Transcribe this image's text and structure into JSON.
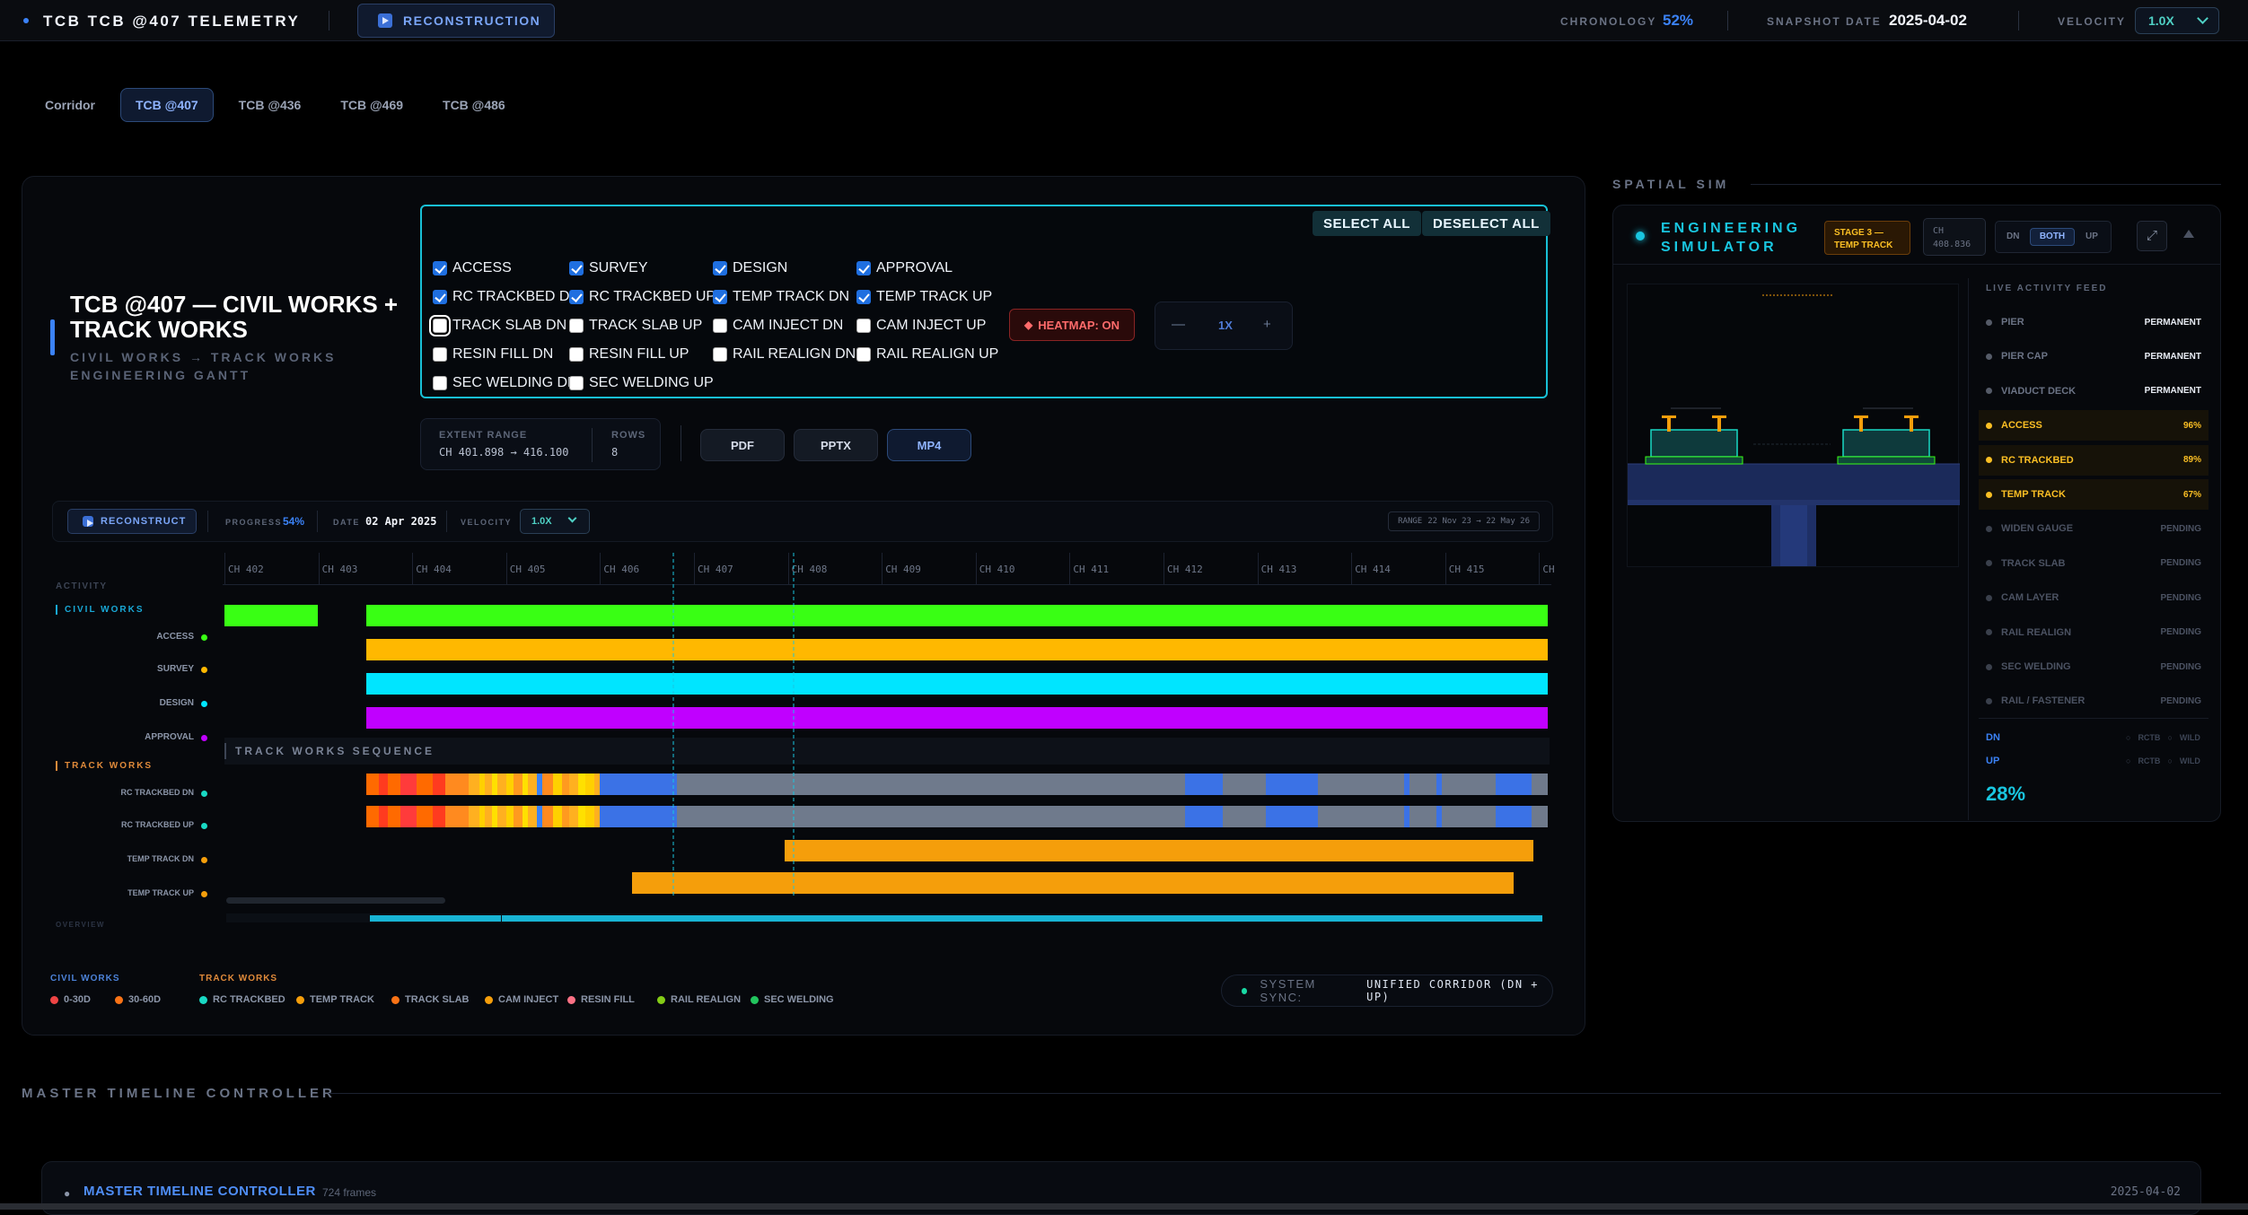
{
  "header": {
    "title": "TCB TCB @407 TELEMETRY",
    "reconstruction_label": "RECONSTRUCTION",
    "chronology_label": "CHRONOLOGY",
    "chronology_value": "52%",
    "snapshot_label": "SNAPSHOT DATE",
    "snapshot_value": "2025-04-02",
    "velocity_label": "VELOCITY",
    "velocity_value": "1.0X"
  },
  "tabs": [
    {
      "label": "Corridor",
      "active": false
    },
    {
      "label": "TCB @407",
      "active": true
    },
    {
      "label": "TCB @436",
      "active": false
    },
    {
      "label": "TCB @469",
      "active": false
    },
    {
      "label": "TCB @486",
      "active": false
    }
  ],
  "panel": {
    "title": "TCB @407 — CIVIL WORKS + TRACK WORKS",
    "subtitle_line1": "CIVIL WORKS → TRACK WORKS",
    "subtitle_line2": "ENGINEERING GANTT"
  },
  "filters": {
    "select_all": "SELECT ALL",
    "deselect_all": "DESELECT ALL",
    "items": [
      {
        "label": "ACCESS",
        "checked": true
      },
      {
        "label": "SURVEY",
        "checked": true
      },
      {
        "label": "DESIGN",
        "checked": true
      },
      {
        "label": "APPROVAL",
        "checked": true
      },
      {
        "label": "RC TRACKBED DN",
        "checked": true
      },
      {
        "label": "RC TRACKBED UP",
        "checked": true
      },
      {
        "label": "TEMP TRACK DN",
        "checked": true
      },
      {
        "label": "TEMP TRACK UP",
        "checked": true
      },
      {
        "label": "TRACK SLAB DN",
        "checked": false
      },
      {
        "label": "TRACK SLAB UP",
        "checked": false
      },
      {
        "label": "CAM INJECT DN",
        "checked": false
      },
      {
        "label": "CAM INJECT UP",
        "checked": false
      },
      {
        "label": "RESIN FILL DN",
        "checked": false
      },
      {
        "label": "RESIN FILL UP",
        "checked": false
      },
      {
        "label": "RAIL REALIGN DN",
        "checked": false
      },
      {
        "label": "RAIL REALIGN UP",
        "checked": false
      },
      {
        "label": "SEC WELDING DN",
        "checked": false
      },
      {
        "label": "SEC WELDING UP",
        "checked": false
      }
    ],
    "heatmap": "HEATMAP: ON",
    "zoom_minus": "—",
    "zoom_value": "1X",
    "zoom_plus": "+"
  },
  "extent": {
    "range_label": "EXTENT RANGE",
    "range_value": "CH 401.898 → 416.100",
    "rows_label": "ROWS",
    "rows_value": "8"
  },
  "exports": {
    "pdf": "PDF",
    "pptx": "PPTX",
    "mp4": "MP4"
  },
  "gantt_controls": {
    "reconstruct": "RECONSTRUCT",
    "progress_label": "PROGRESS",
    "progress_value": "54%",
    "date_label": "DATE",
    "date_value": "02 Apr 2025",
    "velocity_label": "VELOCITY",
    "velocity_value": "1.0X",
    "range_label": "RANGE",
    "range_value": "22 Nov 23 → 22 May 26"
  },
  "gantt": {
    "activity_header": "ACTIVITY",
    "overview_label": "OVERVIEW",
    "chainage_ticks": [
      "CH 402",
      "CH 403",
      "CH 404",
      "CH 405",
      "CH 406",
      "CH 407",
      "CH 408",
      "CH 409",
      "CH 410",
      "CH 411",
      "CH 412",
      "CH 413",
      "CH 414",
      "CH 415",
      "CH"
    ],
    "civil_group": "CIVIL WORKS",
    "track_group": "TRACK WORKS",
    "track_sequence_label": "TRACK WORKS SEQUENCE",
    "civil_rows": [
      {
        "label": "ACCESS",
        "color": "#39ff14"
      },
      {
        "label": "SURVEY",
        "color": "#ffb800"
      },
      {
        "label": "DESIGN",
        "color": "#00e5ff"
      },
      {
        "label": "APPROVAL",
        "color": "#c000ff"
      }
    ],
    "track_rows": [
      {
        "label": "RC TRACKBED DN",
        "color": "#19d9c4"
      },
      {
        "label": "RC TRACKBED UP",
        "color": "#19d9c4"
      },
      {
        "label": "TEMP TRACK DN",
        "color": "#f59e0b"
      },
      {
        "label": "TEMP TRACK UP",
        "color": "#f59e0b"
      }
    ]
  },
  "legend": {
    "civil_title": "CIVIL WORKS",
    "track_title": "TRACK WORKS",
    "civil": [
      {
        "label": "0-30D",
        "color": "#ef4444"
      },
      {
        "label": "30-60D",
        "color": "#f97316"
      }
    ],
    "track": [
      {
        "label": "RC TRACKBED",
        "color": "#19d9c4"
      },
      {
        "label": "TEMP TRACK",
        "color": "#f59e0b"
      },
      {
        "label": "TRACK SLAB",
        "color": "#f97316"
      },
      {
        "label": "CAM INJECT",
        "color": "#f59e0b"
      },
      {
        "label": "RESIN FILL",
        "color": "#fb7185"
      },
      {
        "label": "RAIL REALIGN",
        "color": "#84cc16"
      },
      {
        "label": "SEC WELDING",
        "color": "#22c55e"
      }
    ]
  },
  "sync": {
    "label": "SYSTEM SYNC:",
    "value": "UNIFIED CORRIDOR (DN + UP)"
  },
  "spatial": {
    "header": "SPATIAL SIM",
    "sim_title_1": "ENGINEERING",
    "sim_title_2": "SIMULATOR",
    "stage_line1": "STAGE 3 —",
    "stage_line2": "TEMP TRACK",
    "ch_label": "CH",
    "ch_value": "408.836",
    "dir_dn": "DN",
    "dir_both": "BOTH",
    "dir_up": "UP",
    "feed_title": "LIVE ACTIVITY FEED",
    "feed": [
      {
        "label": "PIER",
        "status": "PERMANENT",
        "color": "#555b68",
        "text": "#6b7385",
        "stcolor": "#e8ecf4",
        "hl": false
      },
      {
        "label": "PIER CAP",
        "status": "PERMANENT",
        "color": "#555b68",
        "text": "#6b7385",
        "stcolor": "#e8ecf4",
        "hl": false
      },
      {
        "label": "VIADUCT DECK",
        "status": "PERMANENT",
        "color": "#555b68",
        "text": "#6b7385",
        "stcolor": "#e8ecf4",
        "hl": false
      },
      {
        "label": "ACCESS",
        "status": "96%",
        "color": "#fbbf24",
        "text": "#fbbf24",
        "stcolor": "#fbbf24",
        "hl": true
      },
      {
        "label": "RC TRACKBED",
        "status": "89%",
        "color": "#fbbf24",
        "text": "#fbbf24",
        "stcolor": "#fbbf24",
        "hl": true
      },
      {
        "label": "TEMP TRACK",
        "status": "67%",
        "color": "#fbbf24",
        "text": "#fbbf24",
        "stcolor": "#fbbf24",
        "hl": true
      },
      {
        "label": "WIDEN GAUGE",
        "status": "PENDING",
        "color": "#3a404c",
        "text": "#4b5262",
        "stcolor": "#4b5262",
        "hl": false
      },
      {
        "label": "TRACK SLAB",
        "status": "PENDING",
        "color": "#3a404c",
        "text": "#4b5262",
        "stcolor": "#4b5262",
        "hl": false
      },
      {
        "label": "CAM LAYER",
        "status": "PENDING",
        "color": "#3a404c",
        "text": "#4b5262",
        "stcolor": "#4b5262",
        "hl": false
      },
      {
        "label": "RAIL REALIGN",
        "status": "PENDING",
        "color": "#3a404c",
        "text": "#4b5262",
        "stcolor": "#4b5262",
        "hl": false
      },
      {
        "label": "SEC WELDING",
        "status": "PENDING",
        "color": "#3a404c",
        "text": "#4b5262",
        "stcolor": "#4b5262",
        "hl": false
      },
      {
        "label": "RAIL / FASTENER",
        "status": "PENDING",
        "color": "#3a404c",
        "text": "#4b5262",
        "stcolor": "#4b5262",
        "hl": false
      }
    ],
    "dn_label": "DN",
    "up_label": "UP",
    "dn_rctb": "RCTB",
    "dn_wild": "WILD",
    "up_rctb": "RCTB",
    "up_wild": "WILD",
    "overall_pct": "28%"
  },
  "master": {
    "header": "MASTER TIMELINE CONTROLLER",
    "title": "MASTER TIMELINE CONTROLLER",
    "frames": "724 frames",
    "date": "2025-04-02"
  }
}
